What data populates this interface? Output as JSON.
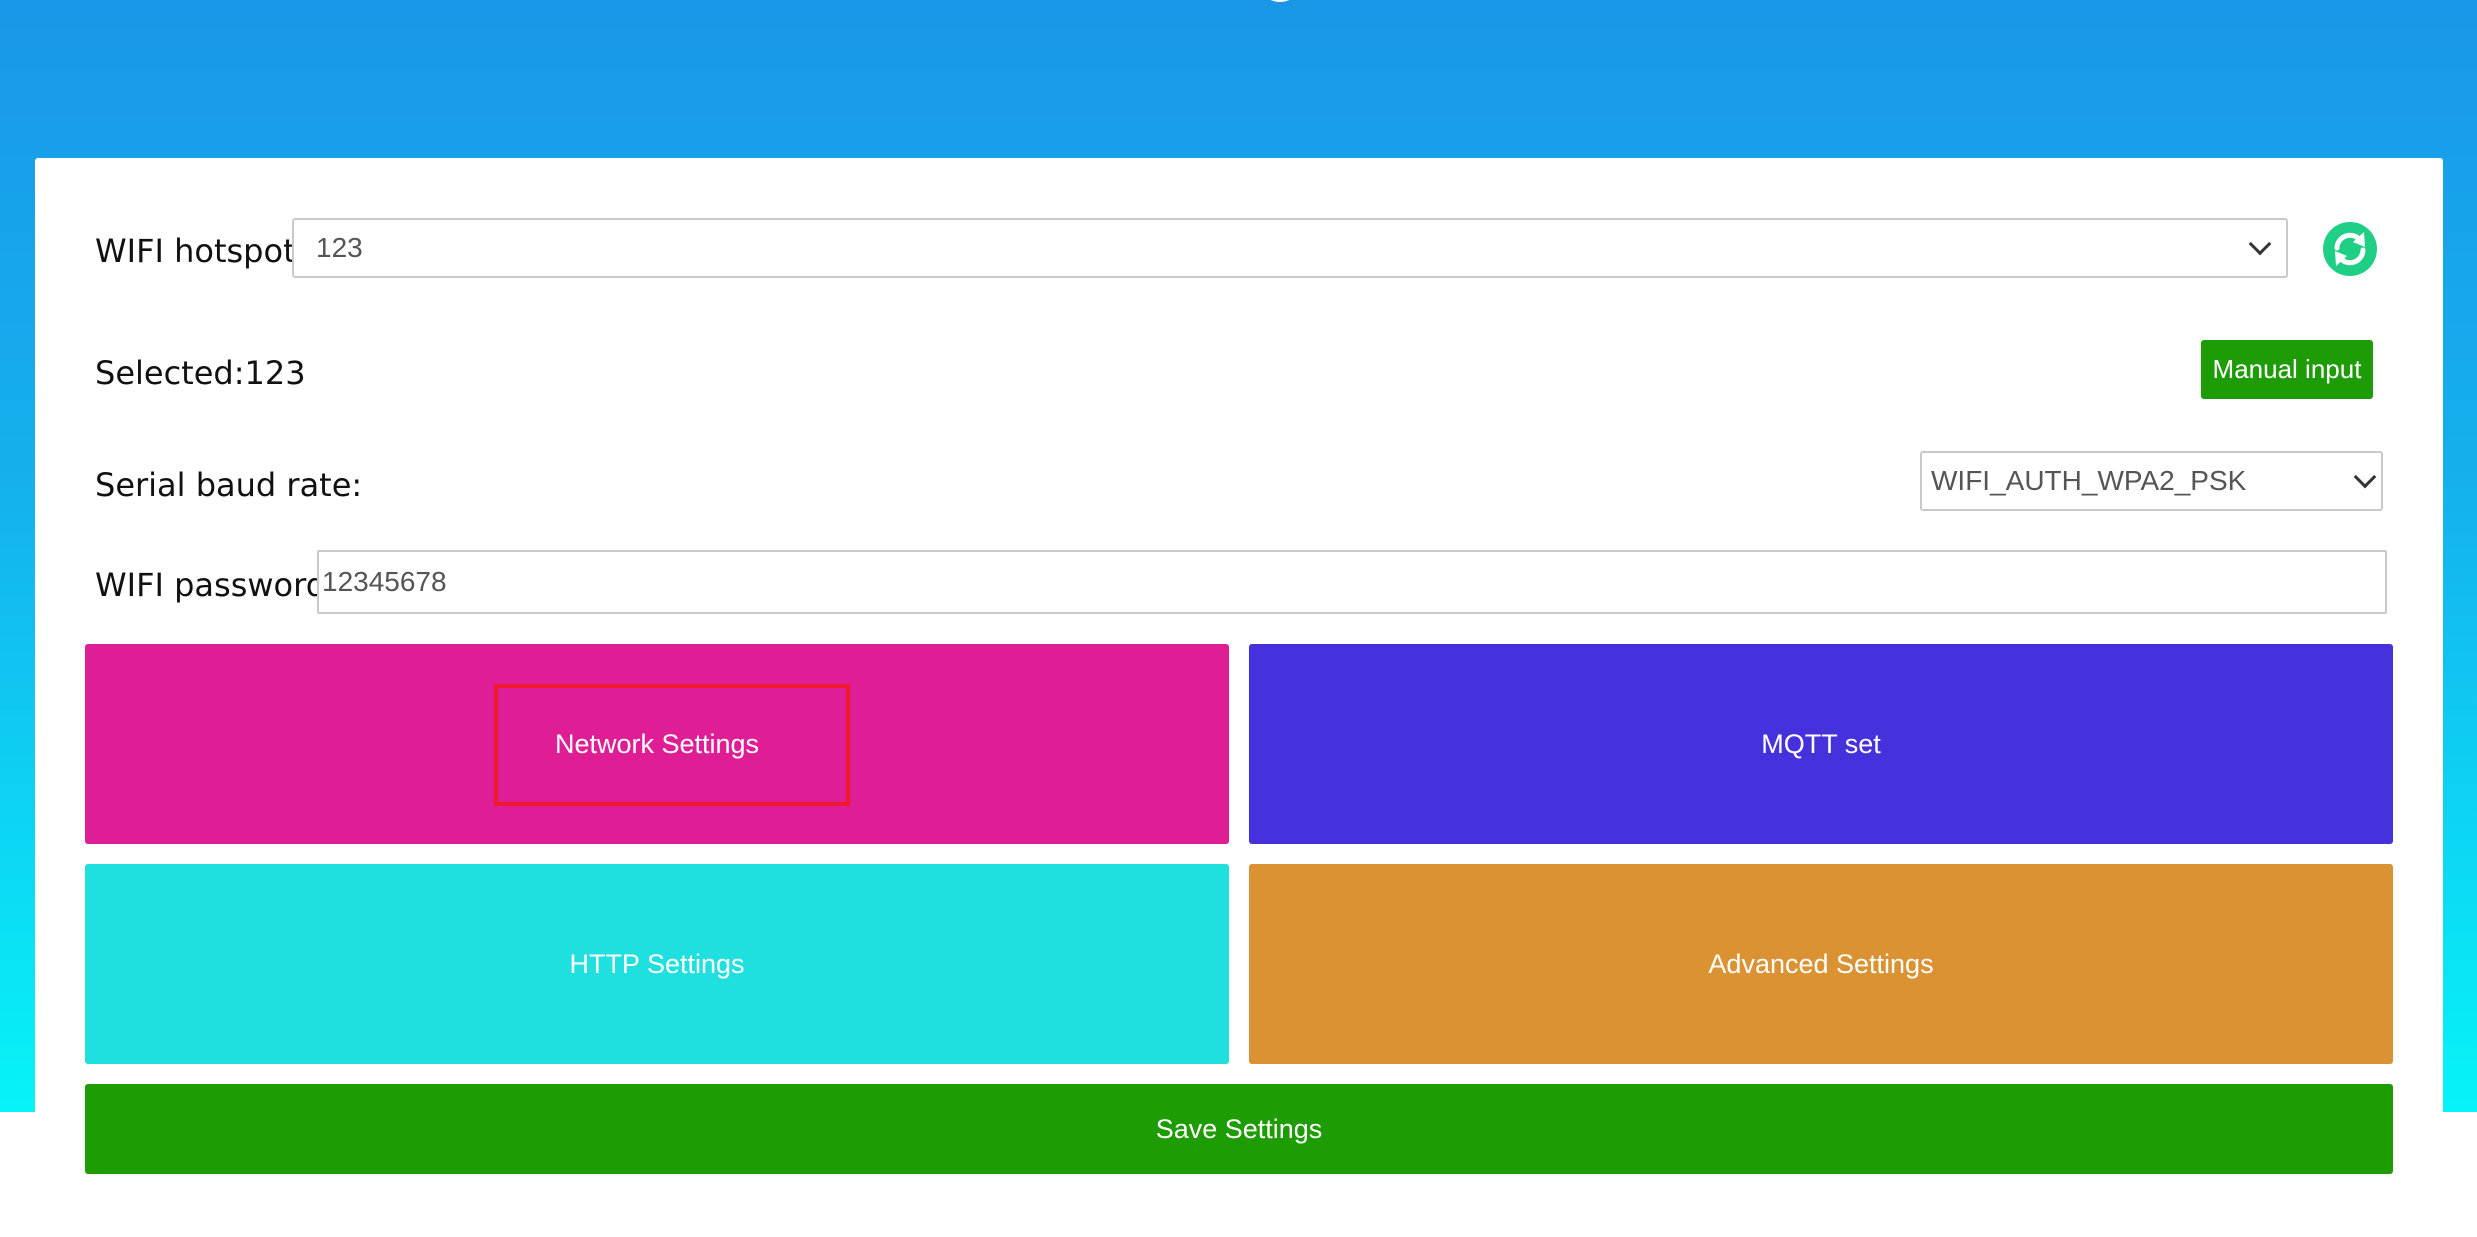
{
  "colors": {
    "header_top": "#1a97e8",
    "header_bottom": "#06f4f8",
    "refresh_icon": "#1ecf85",
    "manual_button": "#1e9c08",
    "network_tile": "#df1e95",
    "mqtt_tile": "#4532dc",
    "http_tile": "#1fe0df",
    "advanced_tile": "#db9233",
    "save_button": "#1e9c04",
    "highlight_border": "#f0182f"
  },
  "wifi": {
    "hotspot_label": "WIFI hotspot:",
    "hotspot_value": "123",
    "refresh_icon": "refresh-icon",
    "selected_text": "Selected:123",
    "manual_input_label": "Manual input"
  },
  "serial": {
    "label": "Serial baud rate:",
    "value": "WIFI_AUTH_WPA2_PSK"
  },
  "password": {
    "label": "WIFI password:",
    "value": "12345678"
  },
  "tiles": {
    "network": "Network Settings",
    "mqtt": "MQTT set",
    "http": "HTTP Settings",
    "advanced": "Advanced Settings"
  },
  "save": {
    "label": "Save Settings"
  }
}
